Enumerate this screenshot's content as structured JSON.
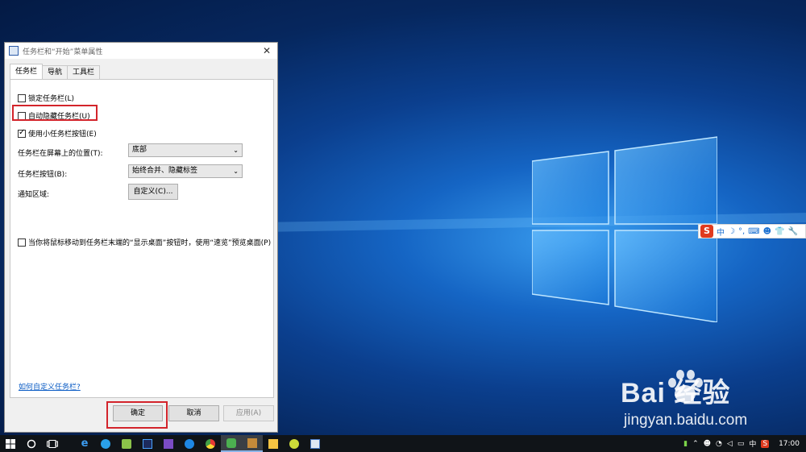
{
  "dialog": {
    "title": "任务栏和“开始”菜单属性",
    "tabs": [
      "任务栏",
      "导航",
      "工具栏"
    ],
    "lock_taskbar": "锁定任务栏(L)",
    "auto_hide": "自动隐藏任务栏(U)",
    "small_buttons": "使用小任务栏按钮(E)",
    "position_label": "任务栏在屏幕上的位置(T):",
    "position_value": "底部",
    "buttons_label": "任务栏按钮(B):",
    "buttons_value": "始终合并、隐藏标签",
    "notify_label": "通知区域:",
    "customize_btn": "自定义(C)...",
    "peek_option": "当你将鼠标移动到任务栏末端的“显示桌面”按钮时，使用“速览”预览桌面(P)",
    "help_link": "如何自定义任务栏?",
    "ok": "确定",
    "cancel": "取消",
    "apply": "应用(A)"
  },
  "ime": {
    "chars": [
      "中",
      "☽",
      "°,",
      "⌨",
      "☻",
      "👕",
      "🔧"
    ]
  },
  "watermark": {
    "brand": "Bai  经验",
    "url": "jingyan.baidu.com"
  },
  "taskbar": {
    "tray_lang": "中",
    "clock": "17:00"
  },
  "colors": {
    "highlight": "#d3242b",
    "accent": "#0a5bc4"
  }
}
